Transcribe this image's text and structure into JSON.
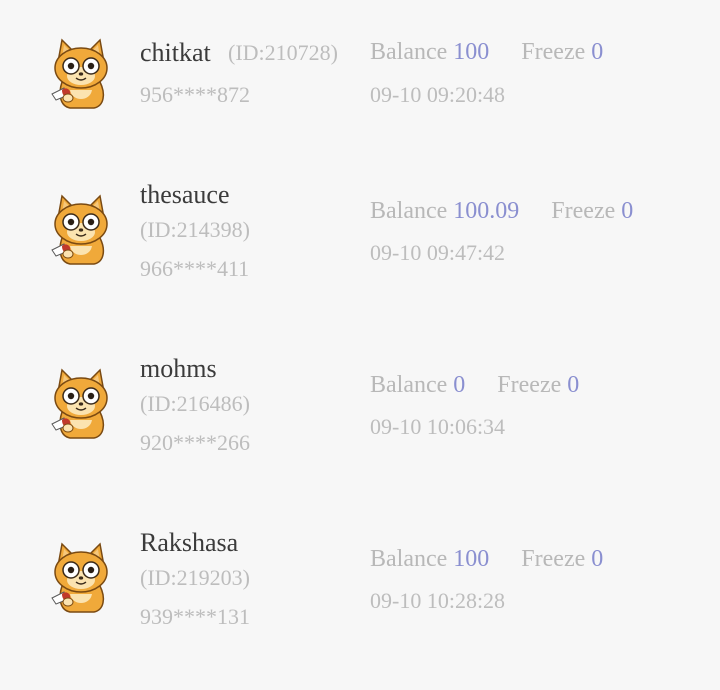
{
  "labels": {
    "balance": "Balance",
    "freeze": "Freeze"
  },
  "colors": {
    "background": "#f7f7f7",
    "name_text": "#3b3b3b",
    "muted_text": "#bdbdbd",
    "value_accent": "#8a8fd0",
    "avatar_fur": "#f0a93a"
  },
  "members": [
    {
      "avatar_icon": "cat-avatar-icon",
      "name": "chitkat",
      "id": "(ID:210728)",
      "phone": "956****872",
      "balance": "100",
      "freeze": "0",
      "time": "09-10 09:20:48"
    },
    {
      "avatar_icon": "cat-avatar-icon",
      "name": "thesauce",
      "id": "(ID:214398)",
      "phone": "966****411",
      "balance": "100.09",
      "freeze": "0",
      "time": "09-10 09:47:42"
    },
    {
      "avatar_icon": "cat-avatar-icon",
      "name": "mohms",
      "id": "(ID:216486)",
      "phone": "920****266",
      "balance": "0",
      "freeze": "0",
      "time": "09-10 10:06:34"
    },
    {
      "avatar_icon": "cat-avatar-icon",
      "name": "Rakshasa",
      "id": "(ID:219203)",
      "phone": "939****131",
      "balance": "100",
      "freeze": "0",
      "time": "09-10 10:28:28"
    }
  ]
}
